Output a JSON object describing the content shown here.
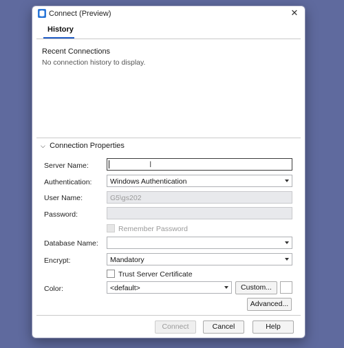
{
  "window": {
    "title": "Connect (Preview)",
    "close_glyph": "✕"
  },
  "tabs": [
    {
      "label": "History"
    }
  ],
  "history": {
    "heading": "Recent Connections",
    "empty_message": "No connection history to display."
  },
  "connection": {
    "section_label": "Connection Properties",
    "server_name": {
      "label": "Server Name:",
      "value": ""
    },
    "authentication": {
      "label": "Authentication:",
      "value": "Windows Authentication"
    },
    "user_name": {
      "label": "User Name:",
      "value": "G5\\gs202"
    },
    "password": {
      "label": "Password:",
      "value": ""
    },
    "remember_password": {
      "label": "Remember Password",
      "checked": false
    },
    "database_name": {
      "label": "Database Name:",
      "value": ""
    },
    "encrypt": {
      "label": "Encrypt:",
      "value": "Mandatory"
    },
    "trust_server_certificate": {
      "label": "Trust Server Certificate",
      "checked": false
    },
    "color": {
      "label": "Color:",
      "value": "<default>",
      "custom_label": "Custom..."
    },
    "advanced_label": "Advanced..."
  },
  "footer": {
    "connect_label": "Connect",
    "cancel_label": "Cancel",
    "help_label": "Help"
  },
  "colors": {
    "background": "#5f6a9e",
    "accent": "#1e5bc6",
    "icon_accent": "#2b77d8"
  }
}
